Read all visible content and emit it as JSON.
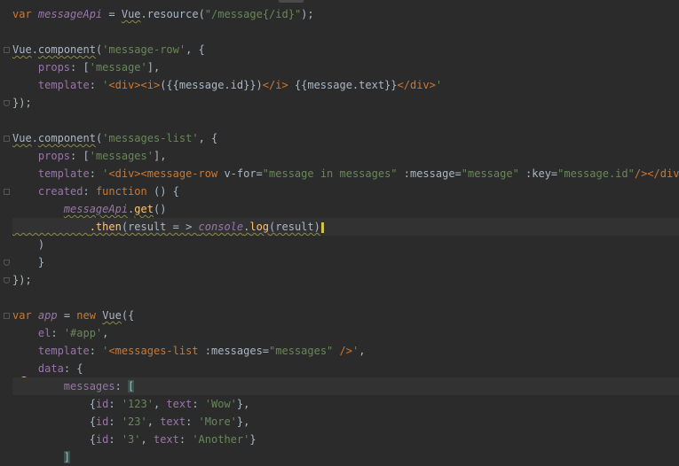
{
  "editor": {
    "language": "javascript",
    "lines": [
      {
        "tokens": [
          [
            "kw",
            "var "
          ],
          [
            "var-i",
            "messageApi"
          ],
          [
            "dflt",
            " = "
          ],
          [
            "dflt-squig",
            "Vue"
          ],
          [
            "dflt",
            "."
          ],
          [
            "dflt",
            "resource"
          ],
          [
            "dflt",
            "("
          ],
          [
            "str",
            "\"/message{/id}\""
          ],
          [
            "dflt",
            ");"
          ]
        ]
      },
      {
        "tokens": []
      },
      {
        "tokens": [
          [
            "dflt-squig",
            "Vue"
          ],
          [
            "dflt",
            "."
          ],
          [
            "dflt-squig",
            "component"
          ],
          [
            "dflt",
            "("
          ],
          [
            "str",
            "'message-row'"
          ],
          [
            "dflt",
            ", {"
          ]
        ]
      },
      {
        "tokens": [
          [
            "dflt",
            "    "
          ],
          [
            "prop",
            "props"
          ],
          [
            "dflt",
            ": ["
          ],
          [
            "str",
            "'message'"
          ],
          [
            "dflt",
            "],"
          ]
        ]
      },
      {
        "tokens": [
          [
            "dflt",
            "    "
          ],
          [
            "prop",
            "template"
          ],
          [
            "dflt",
            ": "
          ],
          [
            "str",
            "'"
          ],
          [
            "kw",
            "<div><i>"
          ],
          [
            "dflt",
            "({{message.id}})"
          ],
          [
            "kw",
            "</i>"
          ],
          [
            "dflt",
            " {{message.text}}"
          ],
          [
            "kw",
            "</div>"
          ],
          [
            "str",
            "'"
          ]
        ]
      },
      {
        "tokens": [
          [
            "dflt",
            "});"
          ]
        ]
      },
      {
        "tokens": []
      },
      {
        "tokens": [
          [
            "dflt-squig",
            "Vue"
          ],
          [
            "dflt",
            "."
          ],
          [
            "dflt-squig",
            "component"
          ],
          [
            "dflt",
            "("
          ],
          [
            "str",
            "'messages-list'"
          ],
          [
            "dflt",
            ", {"
          ]
        ]
      },
      {
        "tokens": [
          [
            "dflt",
            "    "
          ],
          [
            "prop",
            "props"
          ],
          [
            "dflt",
            ": ["
          ],
          [
            "str",
            "'messages'"
          ],
          [
            "dflt",
            "],"
          ]
        ]
      },
      {
        "tokens": [
          [
            "dflt",
            "    "
          ],
          [
            "prop",
            "template"
          ],
          [
            "dflt",
            ": "
          ],
          [
            "str",
            "'"
          ],
          [
            "kw",
            "<div><message-row "
          ],
          [
            "dflt",
            "v-for="
          ],
          [
            "str",
            "\"message in messages\""
          ],
          [
            "dflt",
            " :message="
          ],
          [
            "str",
            "\"message\""
          ],
          [
            "dflt",
            " :key="
          ],
          [
            "str",
            "\"message.id\""
          ],
          [
            "kw",
            "/></div>"
          ],
          [
            "str",
            "'"
          ],
          [
            "dflt",
            ","
          ]
        ]
      },
      {
        "tokens": [
          [
            "dflt",
            "    "
          ],
          [
            "prop",
            "created"
          ],
          [
            "dflt",
            ": "
          ],
          [
            "kw",
            "function "
          ],
          [
            "dflt",
            "() {"
          ]
        ]
      },
      {
        "tokens": [
          [
            "dflt",
            "        "
          ],
          [
            "var-i-squig",
            "messageApi"
          ],
          [
            "dflt",
            "."
          ],
          [
            "fn-squig",
            "get"
          ],
          [
            "dflt",
            "()"
          ]
        ]
      },
      {
        "tokens": [
          [
            "squigpad",
            "            "
          ],
          [
            "fn-squig",
            ".then"
          ],
          [
            "dflt-squig",
            "("
          ],
          [
            "dflt-squig",
            "result = > "
          ],
          [
            "var-i-squig",
            "console"
          ],
          [
            "dflt-squig",
            "."
          ],
          [
            "fn-squig",
            "log"
          ],
          [
            "dflt-squig",
            "(result)"
          ],
          [
            "caret",
            ""
          ]
        ]
      },
      {
        "tokens": [
          [
            "dflt",
            "    )"
          ]
        ]
      },
      {
        "tokens": [
          [
            "dflt",
            "    }"
          ]
        ]
      },
      {
        "tokens": [
          [
            "dflt",
            "});"
          ]
        ]
      },
      {
        "tokens": []
      },
      {
        "tokens": [
          [
            "kw",
            "var "
          ],
          [
            "var-i",
            "app"
          ],
          [
            "dflt",
            " = "
          ],
          [
            "kw",
            "new "
          ],
          [
            "dflt-squig",
            "Vue"
          ],
          [
            "dflt",
            "({"
          ]
        ]
      },
      {
        "tokens": [
          [
            "dflt",
            "    "
          ],
          [
            "prop",
            "el"
          ],
          [
            "dflt",
            ": "
          ],
          [
            "str",
            "'#app'"
          ],
          [
            "dflt",
            ","
          ]
        ]
      },
      {
        "tokens": [
          [
            "dflt",
            "    "
          ],
          [
            "prop",
            "template"
          ],
          [
            "dflt",
            ": "
          ],
          [
            "str",
            "'"
          ],
          [
            "kw",
            "<messages-list "
          ],
          [
            "dflt",
            ":messages="
          ],
          [
            "str",
            "\"messages\""
          ],
          [
            "kw",
            " />"
          ],
          [
            "str",
            "'"
          ],
          [
            "dflt",
            ","
          ]
        ]
      },
      {
        "tokens": [
          [
            "dflt",
            "    "
          ],
          [
            "prop",
            "data"
          ],
          [
            "dflt",
            ": {"
          ]
        ]
      },
      {
        "tokens": [
          [
            "dflt",
            "        "
          ],
          [
            "prop",
            "messages"
          ],
          [
            "dflt",
            ": "
          ],
          [
            "bracket",
            "["
          ]
        ]
      },
      {
        "tokens": [
          [
            "dflt",
            "            {"
          ],
          [
            "prop",
            "id"
          ],
          [
            "dflt",
            ": "
          ],
          [
            "str",
            "'123'"
          ],
          [
            "dflt",
            ", "
          ],
          [
            "prop",
            "text"
          ],
          [
            "dflt",
            ": "
          ],
          [
            "str",
            "'Wow'"
          ],
          [
            "dflt",
            "},"
          ]
        ]
      },
      {
        "tokens": [
          [
            "dflt",
            "            {"
          ],
          [
            "prop",
            "id"
          ],
          [
            "dflt",
            ": "
          ],
          [
            "str",
            "'23'"
          ],
          [
            "dflt",
            ", "
          ],
          [
            "prop",
            "text"
          ],
          [
            "dflt",
            ": "
          ],
          [
            "str",
            "'More'"
          ],
          [
            "dflt",
            "},"
          ]
        ]
      },
      {
        "tokens": [
          [
            "dflt",
            "            {"
          ],
          [
            "prop",
            "id"
          ],
          [
            "dflt",
            ": "
          ],
          [
            "str",
            "'3'"
          ],
          [
            "dflt",
            ", "
          ],
          [
            "prop",
            "text"
          ],
          [
            "dflt",
            ": "
          ],
          [
            "str",
            "'Another'"
          ],
          [
            "dflt",
            "}"
          ]
        ]
      },
      {
        "tokens": [
          [
            "dflt",
            "        "
          ],
          [
            "bracket",
            "]"
          ]
        ]
      }
    ],
    "current_line": 12,
    "lightbulb_line": 21,
    "icons": {
      "lightbulb": "lightbulb-icon",
      "fold": "fold-marker-icon"
    },
    "colors": {
      "background": "#2b2b2b",
      "keyword": "#cc7832",
      "string": "#6a8759",
      "property": "#9876aa",
      "function": "#ffc66d",
      "default": "#a9b7c6"
    }
  }
}
